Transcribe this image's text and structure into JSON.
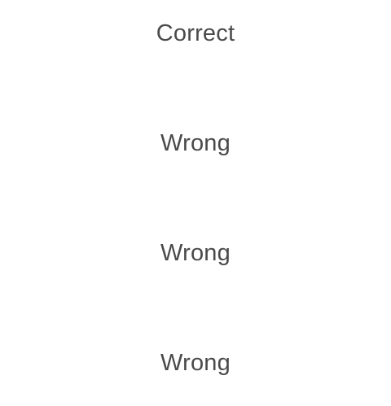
{
  "answer_options": [
    {
      "label": "Correct"
    },
    {
      "label": "Wrong"
    },
    {
      "label": "Wrong"
    },
    {
      "label": "Wrong"
    }
  ],
  "colors": {
    "background": "#ffffff",
    "text": "#4a4a4a"
  }
}
